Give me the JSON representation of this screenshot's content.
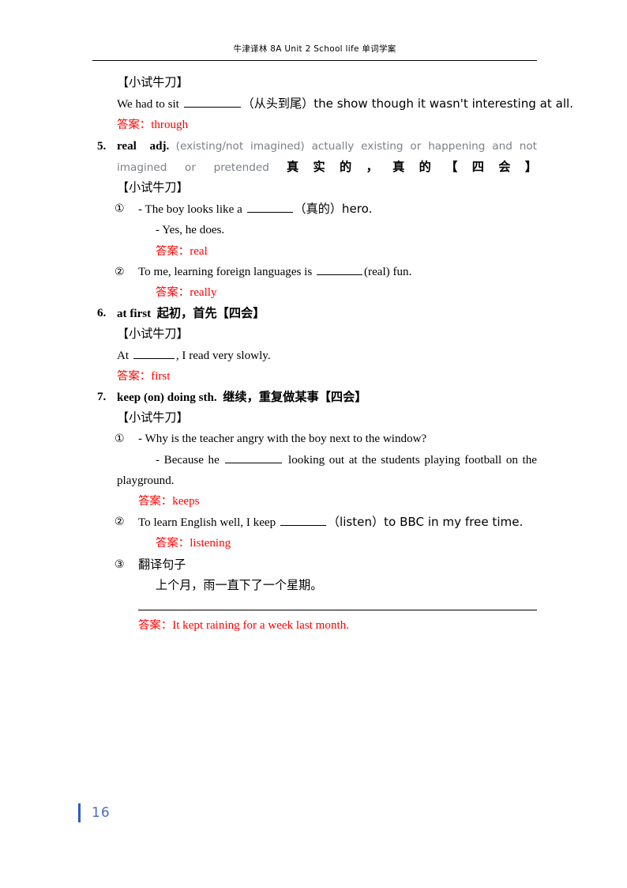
{
  "header": {
    "running_title": "牛津译林 8A Unit 2 School life 单词学案"
  },
  "labels": {
    "try_it": "【小试牛刀】",
    "answer_prefix": "答案：",
    "four_skills": "【四会】",
    "circle_1": "①",
    "circle_2": "②",
    "circle_3": "③"
  },
  "top_block": {
    "try_it": "【小试牛刀】",
    "sentence_pre": "We had to sit ",
    "sentence_post": "（从头到尾）the show though it wasn't interesting at all.",
    "answer_label": "答案：",
    "answer_text": "through"
  },
  "entries": [
    {
      "number": "5.",
      "headword": "real",
      "pos": "adj.",
      "en_def_gray": "(existing/not imagined) actually existing or happening and not imagined or pretended",
      "cn_def": "真实的，真的",
      "tag": "【四会】",
      "try_it": "【小试牛刀】",
      "exercises": [
        {
          "marker": "①",
          "line1_pre": "- The boy looks like a ",
          "line1_post": "（真的）hero.",
          "line2": "- Yes, he does.",
          "answer_label": "答案：",
          "answer_text": "real"
        },
        {
          "marker": "②",
          "line1_pre": "To me, learning foreign languages is ",
          "line1_post": "(real) fun.",
          "answer_label": "答案：",
          "answer_text": "really"
        }
      ]
    },
    {
      "number": "6.",
      "headword": "at first",
      "cn_def": "起初，首先",
      "tag": "【四会】",
      "try_it": "【小试牛刀】",
      "exercises": [
        {
          "marker": "",
          "line1_pre": "At ",
          "line1_post": ", I read very slowly.",
          "answer_label": "答案：",
          "answer_text": "first"
        }
      ]
    },
    {
      "number": "7.",
      "headword": "keep (on) doing sth.",
      "cn_def": "继续，重复做某事",
      "tag": "【四会】",
      "try_it": "【小试牛刀】",
      "exercises": [
        {
          "marker": "①",
          "line1": "- Why is the teacher angry with the boy next to the window?",
          "line2_pre": "- Because he ",
          "line2_post": " looking out at the students playing football on the",
          "line3": "playground.",
          "answer_label": "答案：",
          "answer_text": "keeps"
        },
        {
          "marker": "②",
          "line1_pre": "To learn English well, I keep ",
          "line1_post": "（listen）to BBC in my free time.",
          "answer_label": "答案：",
          "answer_text": "listening"
        },
        {
          "marker": "③",
          "task_title": "翻译句子",
          "cn_sentence": "上个月，雨一直下了一个星期。",
          "answer_label": "答案：",
          "answer_text": "It kept raining for a week last month."
        }
      ]
    }
  ],
  "footer": {
    "page_number": "16"
  },
  "colors": {
    "answer_red": "#ff0000",
    "definition_gray": "#7b7f86",
    "page_number_blue": "#4a6cc0",
    "footer_bar_blue": "#2f5bc4"
  }
}
